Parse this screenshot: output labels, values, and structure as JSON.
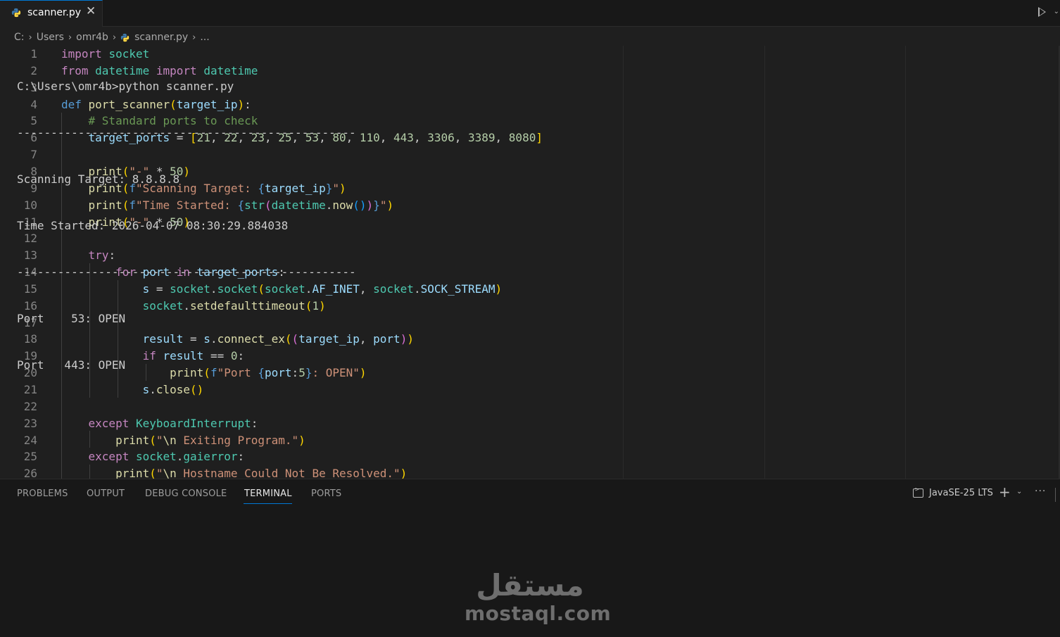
{
  "tab": {
    "title": "scanner.py",
    "close": "✕"
  },
  "breadcrumb": [
    "C:",
    "Users",
    "omr4b",
    "scanner.py",
    "..."
  ],
  "editor": {
    "lines": [
      {
        "n": "1",
        "t": [
          [
            "kw",
            "import "
          ],
          [
            "cls",
            "socket"
          ]
        ]
      },
      {
        "n": "2",
        "t": [
          [
            "kw",
            "from "
          ],
          [
            "cls",
            "datetime "
          ],
          [
            "kw",
            "import "
          ],
          [
            "cls",
            "datetime"
          ]
        ]
      },
      {
        "n": "3",
        "t": []
      },
      {
        "n": "4",
        "t": [
          [
            "def",
            "def "
          ],
          [
            "fn",
            "port_scanner"
          ],
          [
            "b1",
            "("
          ],
          [
            "var",
            "target_ip"
          ],
          [
            "b1",
            ")"
          ],
          [
            "pl",
            ":"
          ]
        ]
      },
      {
        "n": "5",
        "t": [
          [
            "com",
            "    # Standard ports to check"
          ]
        ]
      },
      {
        "n": "6",
        "t": [
          [
            "var",
            "    target_ports "
          ],
          [
            "pl",
            "= "
          ],
          [
            "b1",
            "["
          ],
          [
            "num",
            "21"
          ],
          [
            "pl",
            ", "
          ],
          [
            "num",
            "22"
          ],
          [
            "pl",
            ", "
          ],
          [
            "num",
            "23"
          ],
          [
            "pl",
            ", "
          ],
          [
            "num",
            "25"
          ],
          [
            "pl",
            ", "
          ],
          [
            "num",
            "53"
          ],
          [
            "pl",
            ", "
          ],
          [
            "num",
            "80"
          ],
          [
            "pl",
            ", "
          ],
          [
            "num",
            "110"
          ],
          [
            "pl",
            ", "
          ],
          [
            "num",
            "443"
          ],
          [
            "pl",
            ", "
          ],
          [
            "num",
            "3306"
          ],
          [
            "pl",
            ", "
          ],
          [
            "num",
            "3389"
          ],
          [
            "pl",
            ", "
          ],
          [
            "num",
            "8080"
          ],
          [
            "b1",
            "]"
          ]
        ]
      },
      {
        "n": "7",
        "t": []
      },
      {
        "n": "8",
        "t": [
          [
            "fn",
            "    print"
          ],
          [
            "b1",
            "("
          ],
          [
            "str",
            "\"-\""
          ],
          [
            "pl",
            " * "
          ],
          [
            "num",
            "50"
          ],
          [
            "b1",
            ")"
          ]
        ]
      },
      {
        "n": "9",
        "t": [
          [
            "fn",
            "    print"
          ],
          [
            "b1",
            "("
          ],
          [
            "def",
            "f"
          ],
          [
            "str",
            "\"Scanning Target: "
          ],
          [
            "def",
            "{"
          ],
          [
            "var",
            "target_ip"
          ],
          [
            "def",
            "}"
          ],
          [
            "str",
            "\""
          ],
          [
            "b1",
            ")"
          ]
        ]
      },
      {
        "n": "10",
        "t": [
          [
            "fn",
            "    print"
          ],
          [
            "b1",
            "("
          ],
          [
            "def",
            "f"
          ],
          [
            "str",
            "\"Time Started: "
          ],
          [
            "def",
            "{"
          ],
          [
            "cls",
            "str"
          ],
          [
            "b2",
            "("
          ],
          [
            "cls",
            "datetime"
          ],
          [
            "pl",
            "."
          ],
          [
            "fn",
            "now"
          ],
          [
            "b3",
            "()"
          ],
          [
            "b2",
            ")"
          ],
          [
            "def",
            "}"
          ],
          [
            "str",
            "\""
          ],
          [
            "b1",
            ")"
          ]
        ]
      },
      {
        "n": "11",
        "t": [
          [
            "fn",
            "    print"
          ],
          [
            "b1",
            "("
          ],
          [
            "str",
            "\"-\""
          ],
          [
            "pl",
            " * "
          ],
          [
            "num",
            "50"
          ],
          [
            "b1",
            ")"
          ]
        ]
      },
      {
        "n": "12",
        "t": []
      },
      {
        "n": "13",
        "t": [
          [
            "kw",
            "    try"
          ],
          [
            "pl",
            ":"
          ]
        ]
      },
      {
        "n": "14",
        "t": [
          [
            "kw",
            "        for "
          ],
          [
            "var",
            "port "
          ],
          [
            "kw",
            "in "
          ],
          [
            "var",
            "target_ports"
          ],
          [
            "pl",
            ":"
          ]
        ]
      },
      {
        "n": "15",
        "t": [
          [
            "var",
            "            s "
          ],
          [
            "pl",
            "= "
          ],
          [
            "cls",
            "socket"
          ],
          [
            "pl",
            "."
          ],
          [
            "cls",
            "socket"
          ],
          [
            "b1",
            "("
          ],
          [
            "cls",
            "socket"
          ],
          [
            "pl",
            "."
          ],
          [
            "var",
            "AF_INET"
          ],
          [
            "pl",
            ", "
          ],
          [
            "cls",
            "socket"
          ],
          [
            "pl",
            "."
          ],
          [
            "var",
            "SOCK_STREAM"
          ],
          [
            "b1",
            ")"
          ]
        ]
      },
      {
        "n": "16",
        "t": [
          [
            "cls",
            "            socket"
          ],
          [
            "pl",
            "."
          ],
          [
            "fn",
            "setdefaulttimeout"
          ],
          [
            "b1",
            "("
          ],
          [
            "num",
            "1"
          ],
          [
            "b1",
            ")"
          ]
        ]
      },
      {
        "n": "17",
        "t": []
      },
      {
        "n": "18",
        "t": [
          [
            "var",
            "            result "
          ],
          [
            "pl",
            "= "
          ],
          [
            "var",
            "s"
          ],
          [
            "pl",
            "."
          ],
          [
            "fn",
            "connect_ex"
          ],
          [
            "b1",
            "("
          ],
          [
            "b2",
            "("
          ],
          [
            "var",
            "target_ip"
          ],
          [
            "pl",
            ", "
          ],
          [
            "var",
            "port"
          ],
          [
            "b2",
            ")"
          ],
          [
            "b1",
            ")"
          ]
        ]
      },
      {
        "n": "19",
        "t": [
          [
            "kw",
            "            if "
          ],
          [
            "var",
            "result "
          ],
          [
            "pl",
            "== "
          ],
          [
            "num",
            "0"
          ],
          [
            "pl",
            ":"
          ]
        ]
      },
      {
        "n": "20",
        "t": [
          [
            "fn",
            "                print"
          ],
          [
            "b1",
            "("
          ],
          [
            "def",
            "f"
          ],
          [
            "str",
            "\"Port "
          ],
          [
            "def",
            "{"
          ],
          [
            "var",
            "port"
          ],
          [
            "pl",
            ":"
          ],
          [
            "num",
            "5"
          ],
          [
            "def",
            "}"
          ],
          [
            "str",
            ": OPEN\""
          ],
          [
            "b1",
            ")"
          ]
        ]
      },
      {
        "n": "21",
        "t": [
          [
            "var",
            "            s"
          ],
          [
            "pl",
            "."
          ],
          [
            "fn",
            "close"
          ],
          [
            "b1",
            "()"
          ]
        ]
      },
      {
        "n": "22",
        "t": []
      },
      {
        "n": "23",
        "t": [
          [
            "kw",
            "    except "
          ],
          [
            "cls",
            "KeyboardInterrupt"
          ],
          [
            "pl",
            ":"
          ]
        ]
      },
      {
        "n": "24",
        "t": [
          [
            "fn",
            "        print"
          ],
          [
            "b1",
            "("
          ],
          [
            "str",
            "\""
          ],
          [
            "fn",
            "\\n"
          ],
          [
            "str",
            " Exiting Program.\""
          ],
          [
            "b1",
            ")"
          ]
        ]
      },
      {
        "n": "25",
        "t": [
          [
            "kw",
            "    except "
          ],
          [
            "cls",
            "socket"
          ],
          [
            "pl",
            "."
          ],
          [
            "cls",
            "gaierror"
          ],
          [
            "pl",
            ":"
          ]
        ]
      },
      {
        "n": "26",
        "t": [
          [
            "fn",
            "        print"
          ],
          [
            "b1",
            "("
          ],
          [
            "str",
            "\""
          ],
          [
            "fn",
            "\\n"
          ],
          [
            "str",
            " Hostname Could Not Be Resolved.\""
          ],
          [
            "b1",
            ")"
          ]
        ]
      }
    ]
  },
  "panel": {
    "tabs": [
      "PROBLEMS",
      "OUTPUT",
      "DEBUG CONSOLE",
      "TERMINAL",
      "PORTS"
    ],
    "active_tab": "TERMINAL",
    "terminal_profile": "JavaSE-25 LTS",
    "new_terminal": "+",
    "dropdown": "⌄",
    "more": "···"
  },
  "terminal": {
    "lines": [
      "",
      "C:\\Users\\omr4b>python scanner.py",
      "--------------------------------------------------",
      "Scanning Target: 8.8.8.8",
      "Time Started: 2026-04-07 08:30:29.884038",
      "--------------------------------------------------",
      "Port    53: OPEN",
      "Port   443: OPEN"
    ]
  },
  "watermark": {
    "arabic": "مستقل",
    "latin": "mostaql.com"
  },
  "colors": {
    "keyword": "#c586c0",
    "def": "#569cd6",
    "function": "#dcdcaa",
    "class": "#4ec9b0",
    "variable": "#9cdcfe",
    "string": "#ce9178",
    "number": "#b5cea8",
    "comment": "#6a9955",
    "accent": "#0078d4"
  }
}
